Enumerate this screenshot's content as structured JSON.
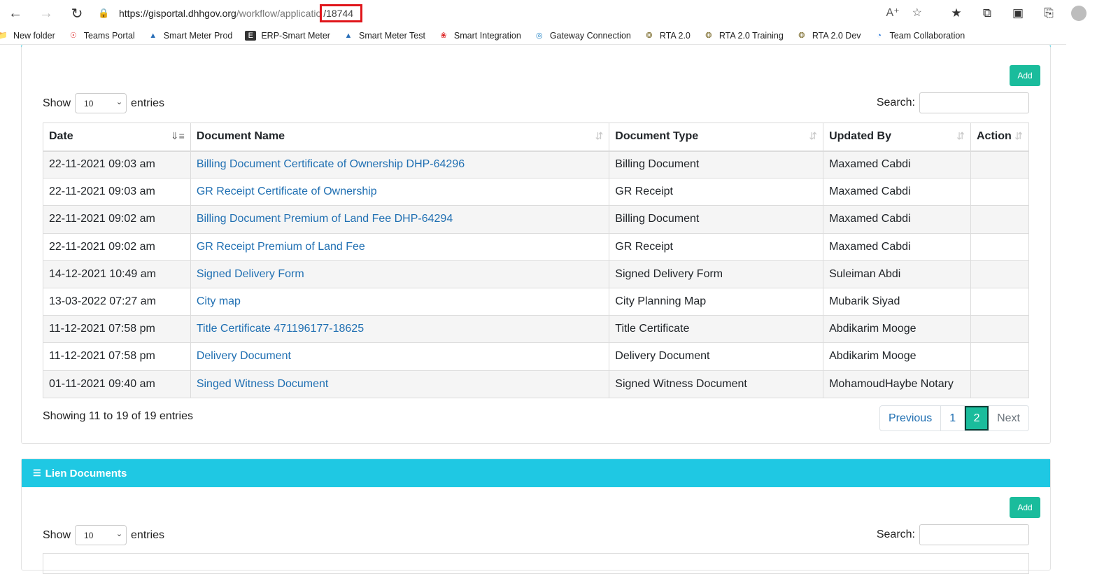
{
  "browser": {
    "url_host": "https://gisportal.dhhgov.org",
    "url_path": "/workflow/applicatio",
    "url_id": "/18744",
    "bookmarks": [
      {
        "label": "New folder",
        "icon": "folder-icon"
      },
      {
        "label": "Teams Portal",
        "icon": "teams-icon"
      },
      {
        "label": "Smart Meter Prod",
        "icon": "drop-icon"
      },
      {
        "label": "ERP-Smart Meter",
        "icon": "e-icon"
      },
      {
        "label": "Smart Meter Test",
        "icon": "drop-icon"
      },
      {
        "label": "Smart Integration",
        "icon": "huawei-icon"
      },
      {
        "label": "Gateway Connection",
        "icon": "gateway-icon"
      },
      {
        "label": "RTA 2.0",
        "icon": "crest-icon"
      },
      {
        "label": "RTA 2.0 Training",
        "icon": "crest-icon"
      },
      {
        "label": "RTA 2.0 Dev",
        "icon": "crest-icon"
      },
      {
        "label": "Team Collaboration",
        "icon": "collab-icon"
      }
    ]
  },
  "documents": {
    "add_label": "Add",
    "show_label": "Show",
    "entries_label": "entries",
    "page_size": "10",
    "search_label": "Search:",
    "columns": [
      "Date",
      "Document Name",
      "Document Type",
      "Updated By",
      "Action"
    ],
    "rows": [
      {
        "date": "22-11-2021 09:03 am",
        "name": "Billing Document Certificate of Ownership DHP-64296",
        "type": "Billing Document",
        "by": "Maxamed Cabdi"
      },
      {
        "date": "22-11-2021 09:03 am",
        "name": "GR Receipt Certificate of Ownership",
        "type": "GR Receipt",
        "by": "Maxamed Cabdi"
      },
      {
        "date": "22-11-2021 09:02 am",
        "name": "Billing Document Premium of Land Fee DHP-64294",
        "type": "Billing Document",
        "by": "Maxamed Cabdi"
      },
      {
        "date": "22-11-2021 09:02 am",
        "name": "GR Receipt Premium of Land Fee",
        "type": "GR Receipt",
        "by": "Maxamed Cabdi"
      },
      {
        "date": "14-12-2021 10:49 am",
        "name": "Signed Delivery Form",
        "type": "Signed Delivery Form",
        "by": "Suleiman Abdi"
      },
      {
        "date": "13-03-2022 07:27 am",
        "name": "City map",
        "type": "City Planning Map",
        "by": "Mubarik Siyad"
      },
      {
        "date": "11-12-2021 07:58 pm",
        "name": "Title Certificate 471196177-18625",
        "type": "Title Certificate",
        "by": "Abdikarim Mooge"
      },
      {
        "date": "11-12-2021 07:58 pm",
        "name": "Delivery Document",
        "type": "Delivery Document",
        "by": "Abdikarim Mooge"
      },
      {
        "date": "01-11-2021 09:40 am",
        "name": "Singed Witness Document",
        "type": "Signed Witness Document",
        "by": "MohamoudHaybe Notary"
      }
    ],
    "info": "Showing 11 to 19 of 19 entries",
    "pagination": {
      "previous": "Previous",
      "pages": [
        "1",
        "2"
      ],
      "current": "2",
      "next": "Next"
    }
  },
  "lien": {
    "title": "Lien Documents",
    "add_label": "Add",
    "show_label": "Show",
    "entries_label": "entries",
    "page_size": "10",
    "search_label": "Search:"
  },
  "colors": {
    "accent": "#1fc8e3",
    "button": "#1abc9c",
    "link": "#1f6fb2",
    "highlight": "#e0161b"
  }
}
